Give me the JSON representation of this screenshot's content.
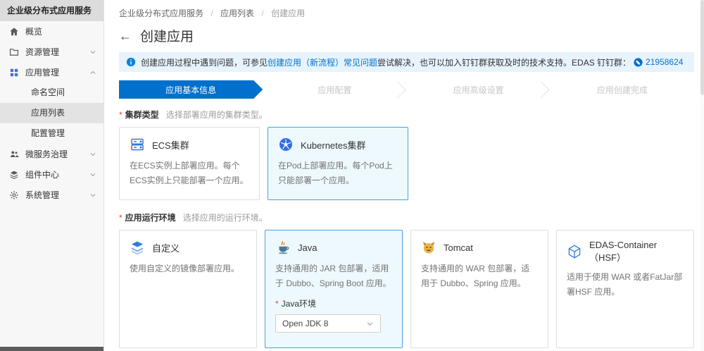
{
  "colors": {
    "accent": "#0070cc",
    "step_active_bg": "#0070cc",
    "selected_card_bg": "#eef9fe",
    "selected_card_border": "#45a2e0",
    "banner_bg": "#e7f3fd",
    "required_mark_color": "#f04134",
    "kubernetes_icon": "#326de6",
    "link": "#0070cc"
  },
  "glyphs": {
    "back": "←",
    "collapse": "«"
  },
  "sidebar": {
    "title": "企业级分布式应用服务",
    "items": [
      {
        "label": "概览",
        "icon": "home-icon"
      },
      {
        "label": "资源管理",
        "icon": "folder-icon",
        "chevron": "down"
      },
      {
        "label": "应用管理",
        "icon": "grid-icon",
        "chevron": "up"
      },
      {
        "label": "命名空间"
      },
      {
        "label": "应用列表",
        "selected": true
      },
      {
        "label": "配置管理"
      },
      {
        "label": "微服务治理",
        "icon": "people-icon",
        "chevron": "down"
      },
      {
        "label": "组件中心",
        "icon": "layers-icon",
        "chevron": "down"
      },
      {
        "label": "系统管理",
        "icon": "gear-icon",
        "chevron": "down"
      }
    ]
  },
  "breadcrumb": {
    "separator": "/",
    "items": [
      "企业级分布式应用服务",
      "应用列表",
      "创建应用"
    ]
  },
  "page": {
    "title": "创建应用"
  },
  "banner": {
    "text_before_link": "创建应用过程中遇到问题，可参见",
    "link": "创建应用（新流程）常见问题",
    "text_after_link": "尝试解决，也可以加入钉钉群获取及时的技术支持。EDAS 钉钉群：",
    "phone": "21958624"
  },
  "steps": [
    {
      "label": "应用基本信息",
      "active": true
    },
    {
      "label": "应用配置",
      "active": false
    },
    {
      "label": "应用高级设置",
      "active": false
    },
    {
      "label": "应用创建完成",
      "active": false
    }
  ],
  "cluster_section": {
    "required_mark": "*",
    "label": "集群类型",
    "helper": "选择部署应用的集群类型。",
    "cards": [
      {
        "title": "ECS集群",
        "desc": "在ECS实例上部署应用。每个ECS实例上只能部署一个应用。",
        "selected": false
      },
      {
        "title": "Kubernetes集群",
        "desc": "在Pod上部署应用。每个Pod上只能部署一个应用。",
        "selected": true
      }
    ]
  },
  "runtime_section": {
    "required_mark": "*",
    "label": "应用运行环境",
    "helper": "选择应用的运行环境。",
    "cards": [
      {
        "title": "自定义",
        "desc": "使用自定义的镜像部署应用。",
        "selected": false
      },
      {
        "title": "Java",
        "desc": "支持通用的 JAR 包部署，适用于 Dubbo、Spring Boot 应用。",
        "selected": true,
        "field_label": "Java环境",
        "field_value": "Open JDK 8"
      },
      {
        "title": "Tomcat",
        "desc": "支持通用的 WAR 包部署，适用于 Dubbo、Spring 应用。",
        "selected": false
      },
      {
        "title": "EDAS-Container（HSF）",
        "desc": "适用于使用 WAR 或者FatJar部署HSF 应用。",
        "selected": false
      }
    ]
  }
}
